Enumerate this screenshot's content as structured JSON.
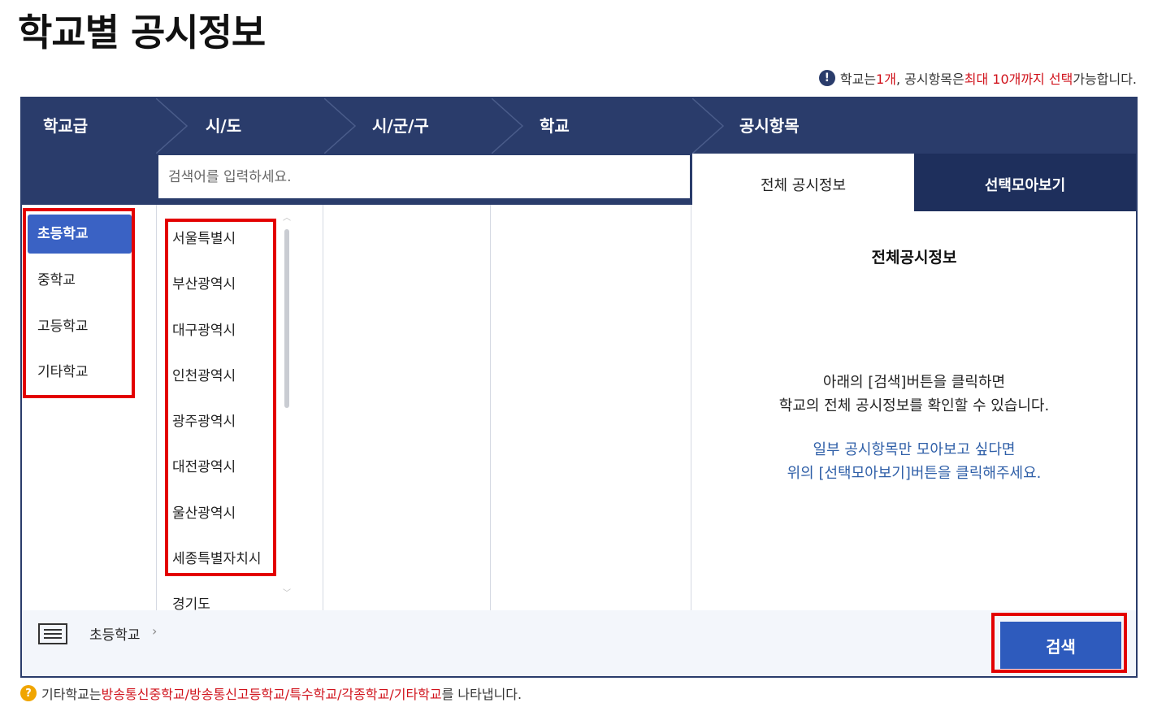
{
  "page": {
    "title": "학교별 공시정보"
  },
  "notice": {
    "icon": "exclamation-icon",
    "part1": "학교는 ",
    "part2": "1개",
    "part3": ", 공시항목은 ",
    "part4": "최대 10개까지 선택",
    "part5": " 가능합니다."
  },
  "steps": [
    "학교급",
    "시/도",
    "시/군/구",
    "학교",
    "공시항목"
  ],
  "search": {
    "placeholder": "검색어를 입력하세요."
  },
  "levels": [
    "초등학교",
    "중학교",
    "고등학교",
    "기타학교"
  ],
  "regions": [
    "서울특별시",
    "부산광역시",
    "대구광역시",
    "인천광역시",
    "광주광역시",
    "대전광역시",
    "울산광역시",
    "세종특별자치시",
    "경기도"
  ],
  "tabs": {
    "all": "전체 공시정보",
    "select": "선택모아보기"
  },
  "info": {
    "title": "전체공시정보",
    "line1": "아래의 [검색]버튼을 클릭하면",
    "line2": "학교의 전체 공시정보를 확인할 수 있습니다.",
    "blue1": "일부 공시항목만 모아보고 싶다면",
    "blue2": "위의 [선택모아보기]버튼을 클릭해주세요."
  },
  "bottom": {
    "crumb": "초등학교",
    "crumb_chevron": "›",
    "icon": "list-icon"
  },
  "buttons": {
    "search": "검색"
  },
  "footer": {
    "icon": "question-icon",
    "part1": "기타학교는 ",
    "part2": "방송통신중학교/방송통신고등학교/특수학교/각종학교/기타학교",
    "part3": "를 나타냅니다."
  },
  "colors": {
    "navy": "#2a3c6b",
    "dark_navy": "#1e2f5c",
    "accent_blue": "#3a62c4",
    "button_blue": "#2e5bbd",
    "highlight_red": "#e30000",
    "text_red": "#d0121b"
  }
}
